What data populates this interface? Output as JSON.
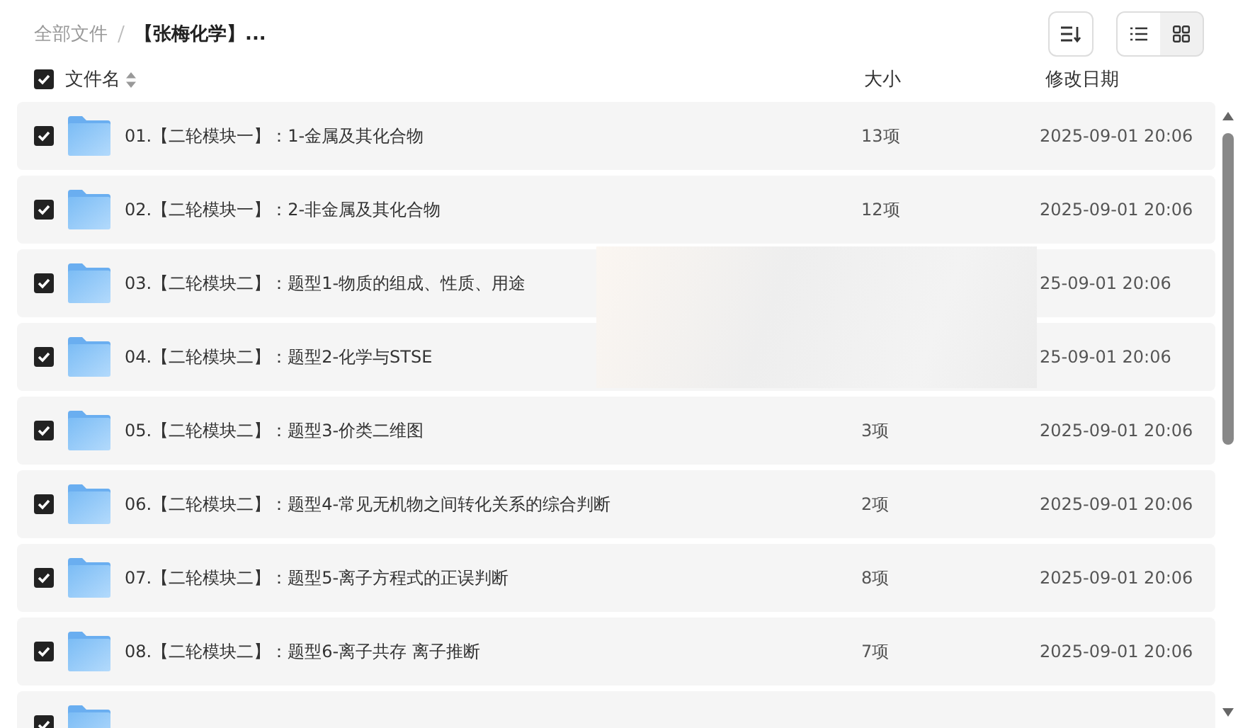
{
  "breadcrumb": [
    {
      "label": "全部文件",
      "current": false
    },
    {
      "label": "【张梅化学】...",
      "current": true
    }
  ],
  "view_modes": [
    {
      "kind": "list",
      "selected": true
    },
    {
      "kind": "grid",
      "selected": false
    }
  ],
  "header": {
    "checked": true,
    "columns": [
      "文件名",
      "大小",
      "修改日期"
    ]
  },
  "rows": [
    {
      "checked": true,
      "name": "01.【二轮模块一】：1-金属及其化合物",
      "size": "13项",
      "date": "2025-09-01 20:06"
    },
    {
      "checked": true,
      "name": "02.【二轮模块一】：2-非金属及其化合物",
      "size": "12项",
      "date": "2025-09-01 20:06"
    },
    {
      "checked": true,
      "name": "03.【二轮模块二】：题型1-物质的组成、性质、用途",
      "date": "25-09-01 20:06"
    },
    {
      "checked": true,
      "name": "04.【二轮模块二】：题型2-化学与STSE",
      "date": "25-09-01 20:06"
    },
    {
      "checked": true,
      "name": "05.【二轮模块二】：题型3-价类二维图",
      "size": "3项",
      "date": "2025-09-01 20:06"
    },
    {
      "checked": true,
      "name": "06.【二轮模块二】：题型4-常见无机物之间转化关系的综合判断",
      "size": "2项",
      "date": "2025-09-01 20:06"
    },
    {
      "checked": true,
      "name": "07.【二轮模块二】：题型5-离子方程式的正误判断",
      "size": "8项",
      "date": "2025-09-01 20:06"
    },
    {
      "checked": true,
      "name": "08.【二轮模块二】：题型6-离子共存 离子推断",
      "size": "7项",
      "date": "2025-09-01 20:06"
    },
    {
      "checked": true
    }
  ]
}
